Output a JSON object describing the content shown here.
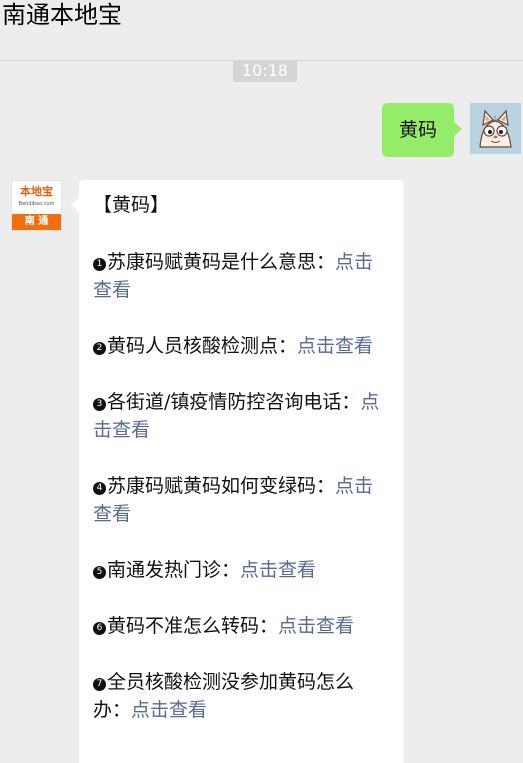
{
  "header": {
    "title": "南通本地宝"
  },
  "chat": {
    "timestamp": "10:18",
    "user_message": "黄码",
    "bot": {
      "logo_main": "本地宝",
      "logo_sub": "Bendibao.com",
      "logo_city": "南 通",
      "title": "【黄码】",
      "items": [
        {
          "num": "1",
          "text": "苏康码赋黄码是什么意思：",
          "link": "点击查看"
        },
        {
          "num": "2",
          "text": "黄码人员核酸检测点：",
          "link": "点击查看"
        },
        {
          "num": "3",
          "text": "各街道/镇疫情防控咨询电话：",
          "link": "点击查看"
        },
        {
          "num": "4",
          "text": "苏康码赋黄码如何变绿码：",
          "link": "点击查看"
        },
        {
          "num": "5",
          "text": "南通发热门诊：",
          "link": "点击查看"
        },
        {
          "num": "6",
          "text": "黄码不准怎么转码：",
          "link": "点击查看"
        },
        {
          "num": "7",
          "text": "全员核酸检测没参加黄码怎么办：",
          "link": "点击查看"
        }
      ]
    }
  }
}
